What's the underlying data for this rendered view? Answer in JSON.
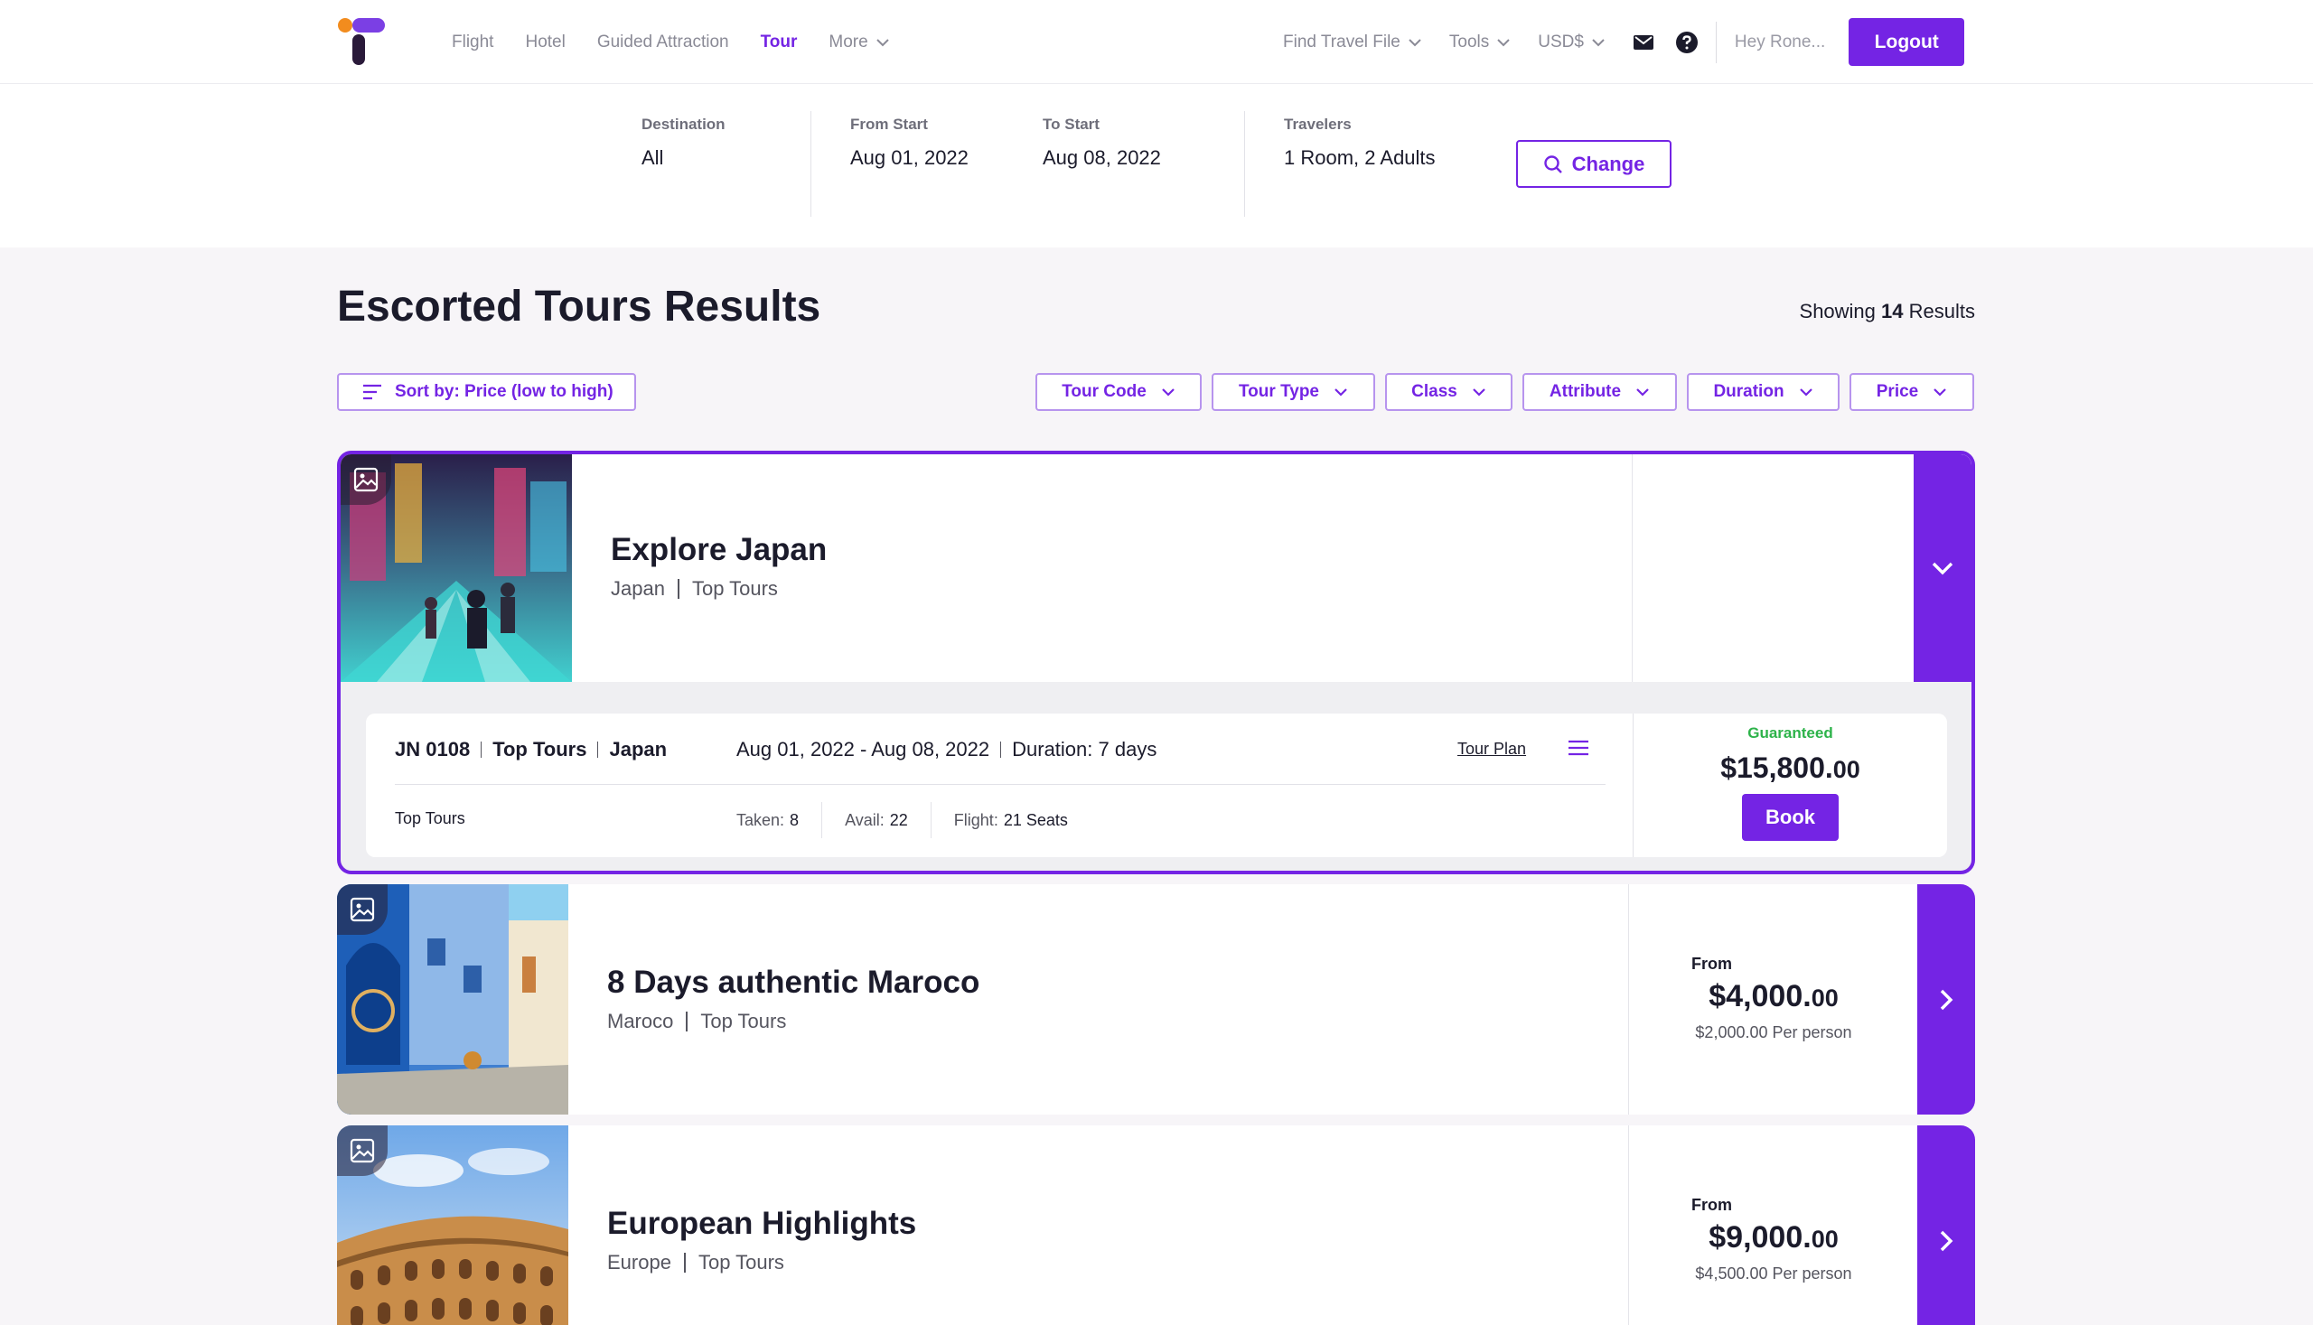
{
  "nav": {
    "links": [
      "Flight",
      "Hotel",
      "Guided Attraction",
      "Tour"
    ],
    "active": "Tour",
    "more": "More",
    "find_travel_file": "Find Travel File",
    "tools": "Tools",
    "currency": "USD$",
    "greeting": "Hey Rone...",
    "logout": "Logout",
    "icons": [
      "mail-icon",
      "help-icon"
    ]
  },
  "search": {
    "destination_label": "Destination",
    "destination_value": "All",
    "from_label": "From Start",
    "from_value": "Aug 01, 2022",
    "to_label": "To Start",
    "to_value": "Aug 08, 2022",
    "travelers_label": "Travelers",
    "travelers_value": "1 Room, 2 Adults",
    "change_label": "Change"
  },
  "results": {
    "title": "Escorted Tours Results",
    "showing_prefix": "Showing",
    "count": "14",
    "showing_suffix": "Results",
    "sort_label": "Sort by: Price (low to high)",
    "filters": [
      "Tour Code",
      "Tour Type",
      "Class",
      "Attribute",
      "Duration",
      "Price"
    ]
  },
  "tours": [
    {
      "title": "Explore Japan",
      "country": "Japan",
      "category": "Top Tours",
      "detail": {
        "code": "JN 0108",
        "category": "Top Tours",
        "country": "Japan",
        "dates": "Aug 01, 2022 - Aug 08, 2022",
        "duration": "Duration: 7 days",
        "tour_plan": "Tour Plan",
        "name": "Top Tours",
        "taken_label": "Taken:",
        "taken": "8",
        "avail_label": "Avail:",
        "avail": "22",
        "flight_label": "Flight:",
        "flight": "21 Seats",
        "status": "Guaranteed",
        "price_main": "$15,800.",
        "price_cents": "00",
        "book": "Book"
      }
    },
    {
      "title": "8 Days authentic Maroco",
      "country": "Maroco",
      "category": "Top Tours",
      "from_label": "From",
      "price_main": "$4,000.",
      "price_cents": "00",
      "per_person": "$2,000.00 Per person"
    },
    {
      "title": "European Highlights",
      "country": "Europe",
      "category": "Top Tours",
      "from_label": "From",
      "price_main": "$9,000.",
      "price_cents": "00",
      "per_person": "$4,500.00 Per person"
    }
  ],
  "colors": {
    "accent": "#7424e4",
    "guaranteed": "#2db34a",
    "background": "#f7f5f8"
  }
}
